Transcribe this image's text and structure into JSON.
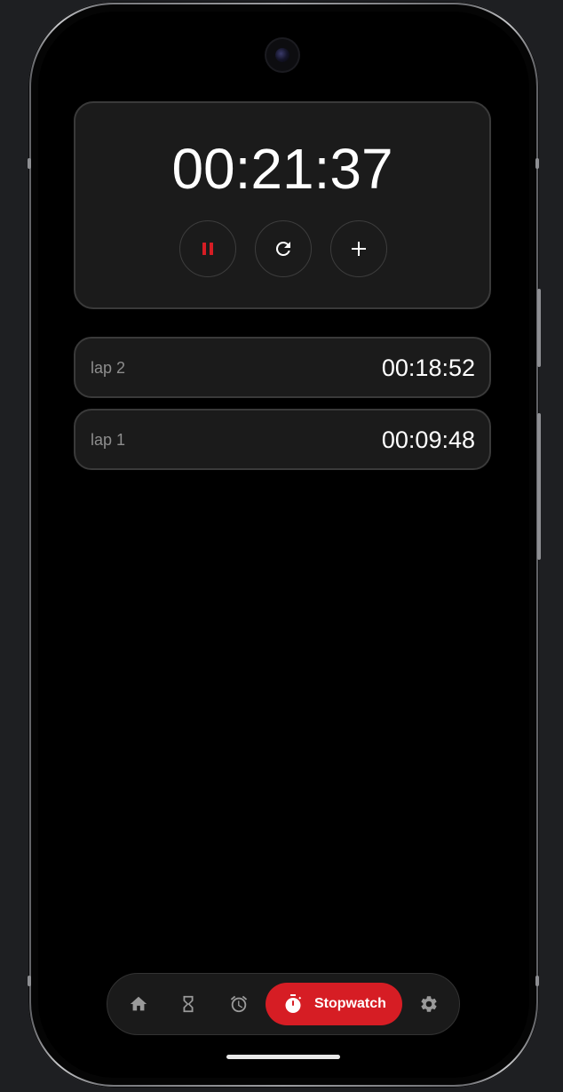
{
  "stopwatch": {
    "elapsed": "00:21:37",
    "state": "running"
  },
  "controls": {
    "pause_icon": "pause-icon",
    "reset_icon": "reset-icon",
    "lap_icon": "plus-icon"
  },
  "laps": [
    {
      "label": "lap 2",
      "time": "00:18:52"
    },
    {
      "label": "lap 1",
      "time": "00:09:48"
    }
  ],
  "nav": {
    "items": [
      {
        "icon": "home-icon",
        "label": ""
      },
      {
        "icon": "hourglass-icon",
        "label": ""
      },
      {
        "icon": "alarm-icon",
        "label": ""
      },
      {
        "icon": "stopwatch-icon",
        "label": "Stopwatch",
        "active": true
      },
      {
        "icon": "gear-icon",
        "label": ""
      }
    ]
  },
  "colors": {
    "accent": "#d61d24",
    "background": "#000000",
    "card": "#1b1b1b",
    "card_border": "#3a3a3a",
    "text_primary": "#ffffff",
    "text_secondary": "#8d8d8d",
    "icon_muted": "#9a9a9a"
  }
}
